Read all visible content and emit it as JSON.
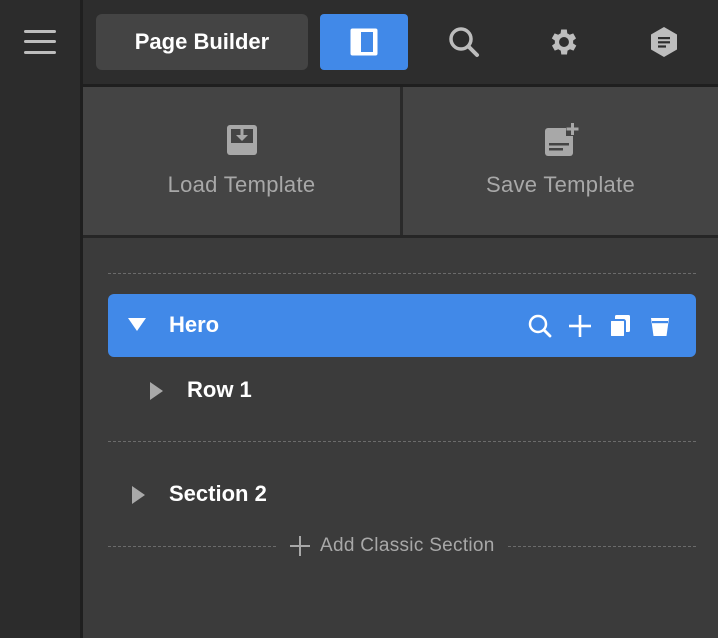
{
  "toolbar": {
    "page_builder_label": "Page Builder",
    "icons": [
      "hamburger-menu",
      "panel-layout",
      "search",
      "settings-gear",
      "page-info"
    ]
  },
  "templates": {
    "load_label": "Load Template",
    "save_label": "Save Template"
  },
  "layers": {
    "items": [
      {
        "label": "Hero",
        "expanded": true,
        "selected": true,
        "actions": [
          "search",
          "add",
          "duplicate",
          "delete"
        ]
      },
      {
        "label": "Row 1",
        "expanded": false,
        "selected": false
      },
      {
        "label": "Section 2",
        "expanded": false,
        "selected": false
      }
    ]
  },
  "add_section": {
    "label": "Add Classic Section"
  },
  "colors": {
    "accent": "#4189e8",
    "panel": "#3b3b3b",
    "topbar": "#2d2d2d",
    "button": "#444444"
  }
}
